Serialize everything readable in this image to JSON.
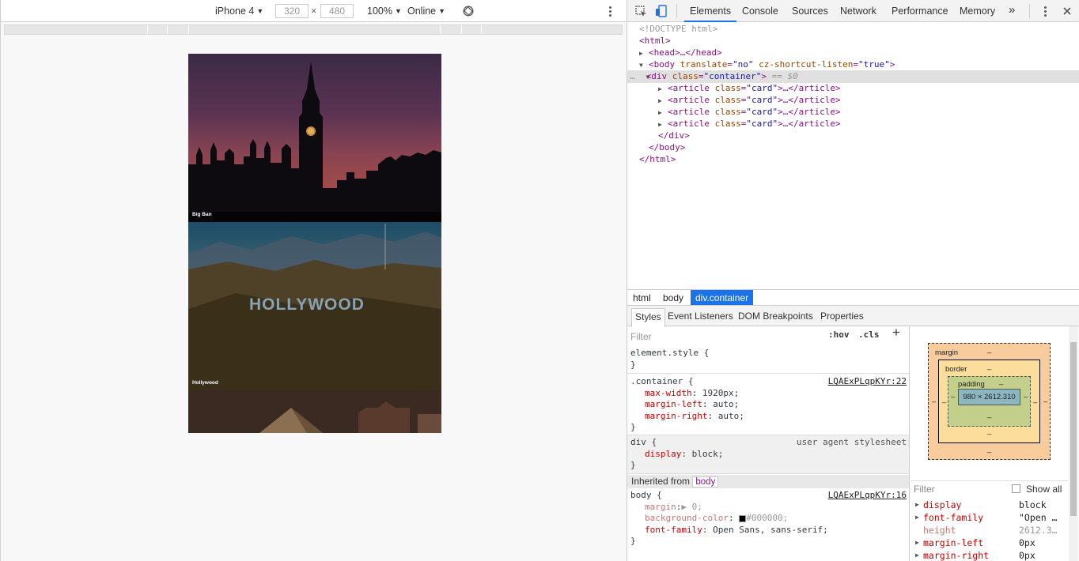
{
  "device_toolbar": {
    "device": "iPhone 4",
    "width": "320",
    "times": "×",
    "height": "480",
    "zoom": "100%",
    "network": "Online",
    "caret": "▼"
  },
  "viewport": {
    "cards": [
      {
        "title": "Big Ban"
      },
      {
        "title": "Hollywood",
        "sign": "HOLLYWOOD"
      },
      {
        "title": ""
      }
    ]
  },
  "devtools": {
    "tabs": [
      "Elements",
      "Console",
      "Sources",
      "Network",
      "Performance",
      "Memory"
    ],
    "more": "»",
    "active_tab": "Elements",
    "dom": {
      "doctype": "<!DOCTYPE html>",
      "html_open": "<html>",
      "head": "<head>…</head>",
      "body_tag": "body",
      "body_attr1": "translate",
      "body_val1": "\"no\"",
      "body_attr2": "cz-shortcut-listen",
      "body_val2": "\"true\"",
      "div_tag": "div",
      "div_attr": "class",
      "div_val": "\"container\"",
      "div_marker": "== $0",
      "article_tag": "article",
      "article_attr": "class",
      "article_val": "\"card\"",
      "article_ellipsis": "…</article>",
      "div_close": "</div>",
      "body_close": "</body>",
      "html_close": "</html>",
      "dots": "…"
    },
    "breadcrumbs": [
      "html",
      "body",
      "div.container"
    ],
    "subtabs": [
      "Styles",
      "Event Listeners",
      "DOM Breakpoints",
      "Properties"
    ],
    "styles": {
      "filter_placeholder": "Filter",
      "hov": ":hov",
      "cls": ".cls",
      "plus": "+",
      "element_style": "element.style {",
      "close_brace": "}",
      "container_selector": ".container {",
      "container_src": "LQAExPLqpKYr:22",
      "container_props": [
        {
          "name": "max-width",
          "value": "1920px;"
        },
        {
          "name": "margin-left",
          "value": "auto;"
        },
        {
          "name": "margin-right",
          "value": "auto;"
        }
      ],
      "div_selector": "div {",
      "div_src": "user agent stylesheet",
      "div_props": [
        {
          "name": "display",
          "value": "block;"
        }
      ],
      "inherited_label": "Inherited from",
      "inherited_tag": "body",
      "body_selector": "body {",
      "body_src": "LQAExPLqpKYr:16",
      "body_props": [
        {
          "name": "margin",
          "value": "▶ 0;",
          "dim": true
        },
        {
          "name": "background-color",
          "value": "#000000;",
          "dim": true,
          "swatch": "#000000"
        },
        {
          "name": "font-family",
          "value": "Open Sans, sans-serif;",
          "dim": false
        }
      ]
    },
    "box_model": {
      "margin_label": "margin",
      "border_label": "border",
      "padding_label": "padding",
      "dash": "–",
      "content_size": "980 × 2612.310"
    },
    "computed": {
      "filter_placeholder": "Filter",
      "show_all": "Show all",
      "rows": [
        {
          "name": "display",
          "value": "block",
          "dim": false,
          "arrow": true
        },
        {
          "name": "font-family",
          "value": "\"Open …",
          "dim": false,
          "arrow": true
        },
        {
          "name": "height",
          "value": "2612.3…",
          "dim": true,
          "arrow": false
        },
        {
          "name": "margin-left",
          "value": "0px",
          "dim": false,
          "arrow": true
        },
        {
          "name": "margin-right",
          "value": "0px",
          "dim": false,
          "arrow": true
        }
      ]
    }
  },
  "colors": {
    "accent": "#1a73e8",
    "tag": "#881280",
    "attr": "#994500",
    "value": "#1a1aa6",
    "prop": "#c80000"
  }
}
